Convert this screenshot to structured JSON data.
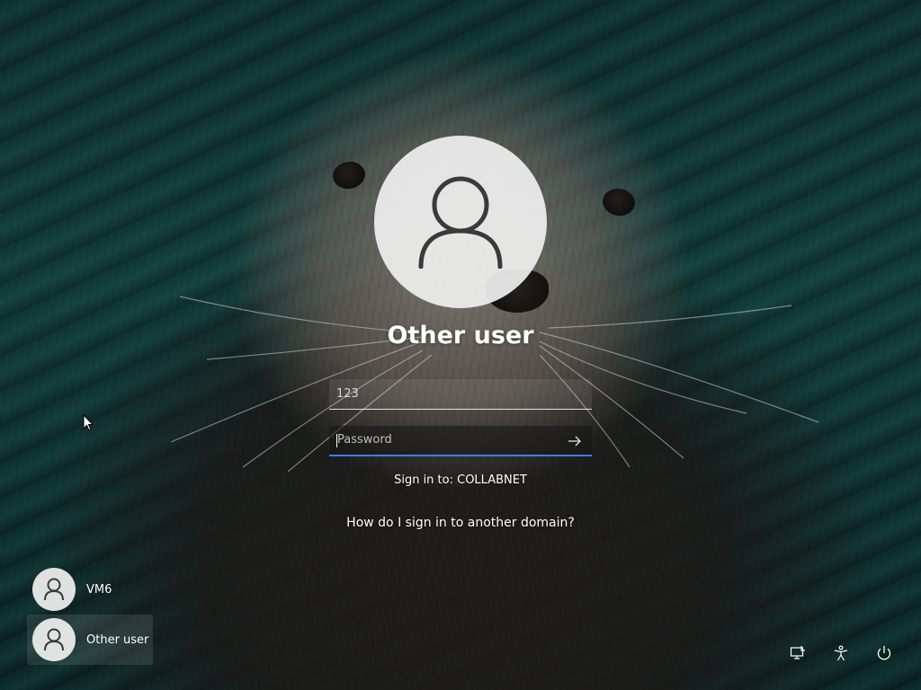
{
  "screen": {
    "type": "windows-sign-in",
    "background": "sea-otter-wallpaper"
  },
  "sign_in": {
    "user_title": "Other user",
    "username_value": "123",
    "password_placeholder": "Password",
    "signin_to_text": "Sign in to: COLLABNET",
    "domain_help_link": "How do I sign in to another domain?",
    "submit_icon": "arrow-right-icon",
    "focus_color": "#3b7ee6"
  },
  "user_list": {
    "items": [
      {
        "name": "VM6",
        "icon": "user-icon",
        "selected": false
      },
      {
        "name": "Other user",
        "icon": "user-icon",
        "selected": true
      }
    ]
  },
  "system_icons": [
    {
      "name": "network-icon"
    },
    {
      "name": "accessibility-icon"
    },
    {
      "name": "power-icon"
    }
  ]
}
